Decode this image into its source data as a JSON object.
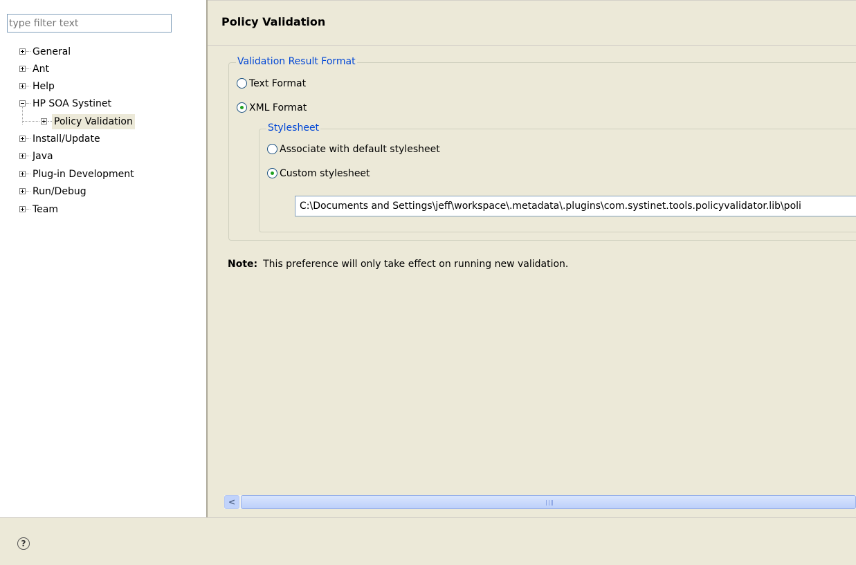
{
  "filter": {
    "placeholder": "type filter text"
  },
  "tree": {
    "items": [
      {
        "label": "General"
      },
      {
        "label": "Ant"
      },
      {
        "label": "Help"
      },
      {
        "label": "HP SOA Systinet"
      },
      {
        "label": "Policy Validation"
      },
      {
        "label": "Install/Update"
      },
      {
        "label": "Java"
      },
      {
        "label": "Plug-in Development"
      },
      {
        "label": "Run/Debug"
      },
      {
        "label": "Team"
      }
    ]
  },
  "page": {
    "title": "Policy Validation"
  },
  "format_group": {
    "legend": "Validation Result Format",
    "text_option": "Text Format",
    "xml_option": "XML Format",
    "selected": "XML Format"
  },
  "stylesheet_group": {
    "legend": "Stylesheet",
    "default_option": "Associate with default stylesheet",
    "custom_option": "Custom stylesheet",
    "selected": "Custom stylesheet",
    "path_value": "C:\\Documents and Settings\\jeff\\workspace\\.metadata\\.plugins\\com.systinet.tools.policyvalidator.lib\\poli"
  },
  "note": {
    "label": "Note:",
    "text": "This preference will only take effect on running new validation."
  },
  "scrollbar": {
    "left_arrow": "<"
  },
  "help": {
    "icon": "help-icon",
    "glyph": "?"
  }
}
